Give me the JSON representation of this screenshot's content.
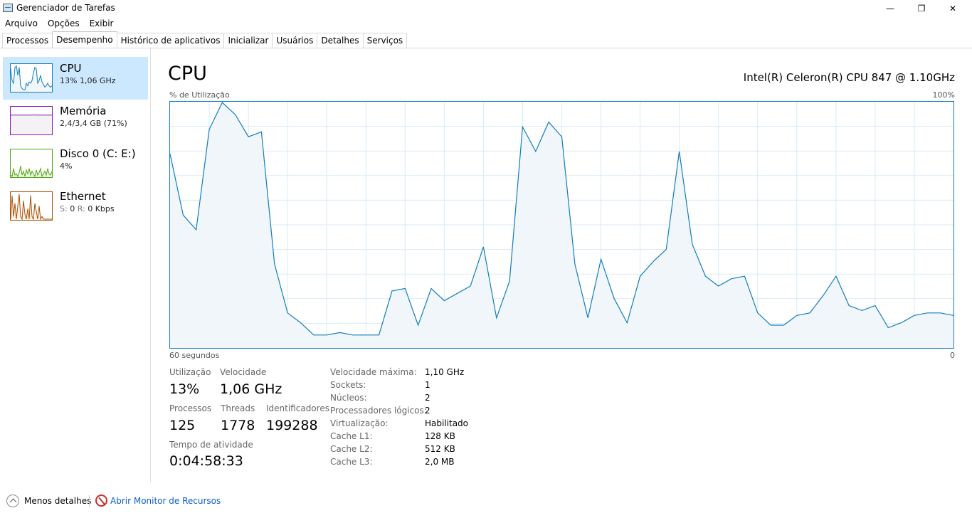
{
  "window": {
    "title": "Gerenciador de Tarefas",
    "minimize_glyph": "—",
    "restore_glyph": "❐",
    "close_glyph": "✕"
  },
  "menu": [
    "Arquivo",
    "Opções",
    "Exibir"
  ],
  "tabs": [
    {
      "label": "Processos",
      "active": false
    },
    {
      "label": "Desempenho",
      "active": true
    },
    {
      "label": "Histórico de aplicativos",
      "active": false
    },
    {
      "label": "Inicializar",
      "active": false
    },
    {
      "label": "Usuários",
      "active": false
    },
    {
      "label": "Detalhes",
      "active": false
    },
    {
      "label": "Serviços",
      "active": false
    }
  ],
  "sidebar": {
    "items": [
      {
        "name": "CPU",
        "sub": "13%  1,06 GHz",
        "color": "#117dbb",
        "fill": "#f1f6fa",
        "selected": true,
        "spark": [
          0.85,
          0.4,
          0.3,
          0.9,
          0.95,
          0.6,
          0.9,
          0.2,
          0.1,
          0.05,
          0.05,
          0.3,
          0.2,
          0.35,
          0.3,
          0.4,
          0.7,
          0.9,
          0.85,
          0.3,
          0.4,
          0.6,
          0.35,
          0.25,
          0.15,
          0.2,
          0.3,
          0.2,
          0.15,
          0.2
        ]
      },
      {
        "name": "Memória",
        "sub": "2,4/3,4 GB (71%)",
        "color": "#8b12ae",
        "fill": "#f4f2f4",
        "selected": false,
        "spark": [
          0.71,
          0.71,
          0.71,
          0.71,
          0.71,
          0.71,
          0.71,
          0.71,
          0.71,
          0.71,
          0.71,
          0.71,
          0.71,
          0.71,
          0.71,
          0.71,
          0.72,
          0.71,
          0.71,
          0.71,
          0.71,
          0.71,
          0.71,
          0.71,
          0.71,
          0.71,
          0.71,
          0.71,
          0.71,
          0.71
        ]
      },
      {
        "name": "Disco 0 (C: E:)",
        "sub": "4%",
        "color": "#4da60c",
        "fill": "#eff7e8",
        "selected": false,
        "spark": [
          0.05,
          0.0,
          0.3,
          0.05,
          0.1,
          0.0,
          0.15,
          0.4,
          0.05,
          0.2,
          0.0,
          0.25,
          0.1,
          0.3,
          0.05,
          0.2,
          0.1,
          0.0,
          0.25,
          0.05,
          0.15,
          0.3,
          0.0,
          0.1,
          0.2,
          0.05,
          0.3,
          0.1,
          0.05,
          0.2
        ]
      },
      {
        "name": "Ethernet",
        "sub_prefix_s": "S:",
        "sub_s": "0",
        "sub_prefix_r": "R:",
        "sub_r": "0 Kbps",
        "color": "#a74f01",
        "fill": "#fcf3eb",
        "selected": false,
        "spark": [
          0.0,
          0.9,
          0.1,
          0.6,
          0.0,
          0.5,
          0.95,
          0.1,
          0.0,
          0.7,
          0.2,
          0.0,
          0.4,
          0.0,
          0.9,
          0.1,
          0.0,
          0.6,
          0.3,
          0.0,
          0.5,
          0.0,
          0.1,
          0.0,
          0.0,
          0.0,
          0.0,
          0.0,
          0.0,
          0.0
        ]
      }
    ]
  },
  "main": {
    "title": "CPU",
    "model": "Intel(R) Celeron(R) CPU 847 @ 1.10GHz",
    "y_label": "% de Utilização",
    "y_max_label": "100%",
    "x_left_label": "60 segundos",
    "x_right_label": "0"
  },
  "chart_data": {
    "type": "area",
    "title": "CPU",
    "ylabel": "% de Utilização",
    "xlabel": "60 segundos",
    "ylim": [
      0,
      100
    ],
    "xlim": [
      60,
      0
    ],
    "grid": true,
    "color": "#117dbb",
    "fill": "#f1f6fa",
    "x": [
      60,
      59,
      58,
      57,
      56,
      55,
      54,
      53,
      52,
      51,
      50,
      49,
      48,
      47,
      46,
      45,
      44,
      43,
      42,
      41,
      40,
      39,
      38,
      37,
      36,
      35,
      34,
      33,
      32,
      31,
      30,
      29,
      28,
      27,
      26,
      25,
      24,
      23,
      22,
      21,
      20,
      19,
      18,
      17,
      16,
      15,
      14,
      13,
      12,
      11,
      10,
      9,
      8,
      7,
      6,
      5,
      4,
      3,
      2,
      1,
      0
    ],
    "y": [
      79,
      54,
      48,
      89,
      100,
      95,
      86,
      88,
      34,
      14,
      10,
      5,
      5,
      6,
      5,
      5,
      5,
      23,
      24,
      9,
      24,
      19,
      22,
      25,
      41,
      12,
      27,
      90,
      80,
      92,
      86,
      34,
      12,
      36,
      20,
      10,
      29,
      35,
      40,
      80,
      42,
      29,
      25,
      28,
      29,
      14,
      9,
      9,
      13,
      14,
      21,
      29,
      17,
      15,
      17,
      8,
      10,
      13,
      14,
      14,
      13
    ]
  },
  "stats": {
    "utilizacao_label": "Utilização",
    "utilizacao": "13%",
    "velocidade_label": "Velocidade",
    "velocidade": "1,06 GHz",
    "processos_label": "Processos",
    "processos": "125",
    "threads_label": "Threads",
    "threads": "1778",
    "ident_label": "Identificadores",
    "ident": "199288",
    "uptime_label": "Tempo de atividade",
    "uptime": "0:04:58:33"
  },
  "details": [
    {
      "label": "Velocidade máxima:",
      "value": "1,10 GHz"
    },
    {
      "label": "Sockets:",
      "value": "1"
    },
    {
      "label": "Núcleos:",
      "value": "2"
    },
    {
      "label": "Processadores lógicos:",
      "value": "2"
    },
    {
      "label": "Virtualização:",
      "value": "Habilitado"
    },
    {
      "label": "Cache L1:",
      "value": "128 KB"
    },
    {
      "label": "Cache L2:",
      "value": "512 KB"
    },
    {
      "label": "Cache L3:",
      "value": "2,0 MB"
    }
  ],
  "footer": {
    "less_details": "Menos detalhes",
    "resource_monitor": "Abrir Monitor de Recursos"
  }
}
